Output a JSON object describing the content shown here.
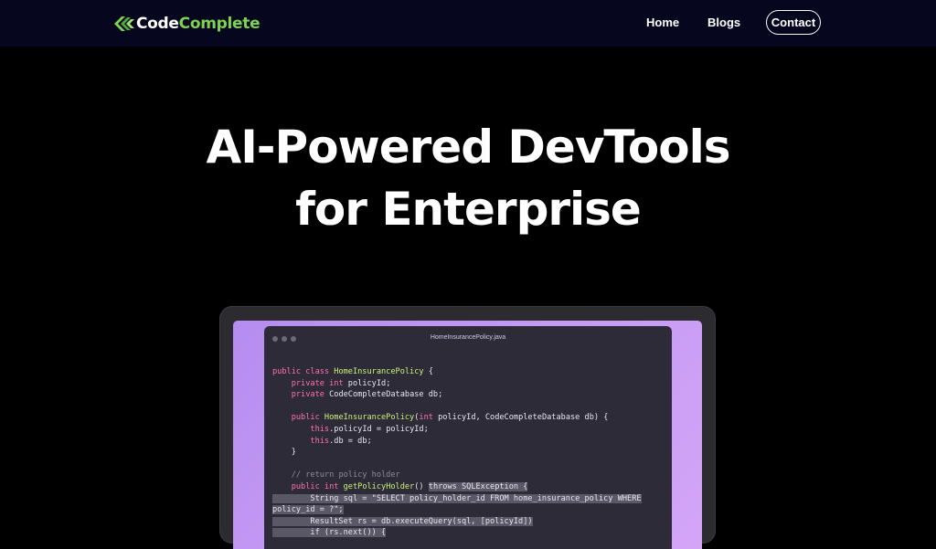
{
  "nav": {
    "logo": {
      "part1": "Code",
      "part2": "Complete"
    },
    "links": [
      {
        "label": "Home"
      },
      {
        "label": "Blogs"
      }
    ],
    "contact_label": "Contact"
  },
  "hero": {
    "title_line1": "AI-Powered DevTools",
    "title_line2": "for Enterprise"
  },
  "editor": {
    "filename": "HomeInsurancePolicy.java",
    "lines": [
      [
        {
          "t": "public class ",
          "c": "kw"
        },
        {
          "t": "HomeInsurancePolicy",
          "c": "cls"
        },
        {
          "t": " {"
        }
      ],
      [
        {
          "t": "    "
        },
        {
          "t": "private int ",
          "c": "kw"
        },
        {
          "t": "policyId;"
        }
      ],
      [
        {
          "t": "    "
        },
        {
          "t": "private ",
          "c": "kw"
        },
        {
          "t": "CodeCompleteDatabase db;"
        }
      ],
      [],
      [
        {
          "t": "    "
        },
        {
          "t": "public ",
          "c": "kw"
        },
        {
          "t": "HomeInsurancePolicy",
          "c": "cls"
        },
        {
          "t": "("
        },
        {
          "t": "int ",
          "c": "kw"
        },
        {
          "t": "policyId, CodeCompleteDatabase db) {"
        }
      ],
      [
        {
          "t": "        "
        },
        {
          "t": "this",
          "c": "kw"
        },
        {
          "t": ".policyId = policyId;"
        }
      ],
      [
        {
          "t": "        "
        },
        {
          "t": "this",
          "c": "kw"
        },
        {
          "t": ".db = db;"
        }
      ],
      [
        {
          "t": "    }"
        }
      ],
      [],
      [
        {
          "t": "    "
        },
        {
          "t": "// return policy holder",
          "c": "com"
        }
      ],
      [
        {
          "t": "    "
        },
        {
          "t": "public int ",
          "c": "kw"
        },
        {
          "t": "getPolicyHolder",
          "c": "cls"
        },
        {
          "t": "() "
        },
        {
          "t": "throws SQLException {",
          "c": "sel"
        }
      ],
      [
        {
          "t": "        String sql = \"SELECT policy_holder_id FROM home_insurance_policy WHERE",
          "c": "sel"
        }
      ],
      [
        {
          "t": "policy_id = ?\";",
          "c": "sel"
        }
      ],
      [
        {
          "t": "        ResultSet rs = db.executeQuery(sql, [policyId])",
          "c": "sel"
        }
      ],
      [
        {
          "t": "        if (rs.next()) {",
          "c": "sel"
        }
      ]
    ]
  },
  "colors": {
    "nav_bg": "#06061f",
    "logo_accent": "#7cd352",
    "keyword": "#ff6fae",
    "class_name": "#c9f27a",
    "comment": "#8d8a9c",
    "selection": "#5a5766"
  }
}
